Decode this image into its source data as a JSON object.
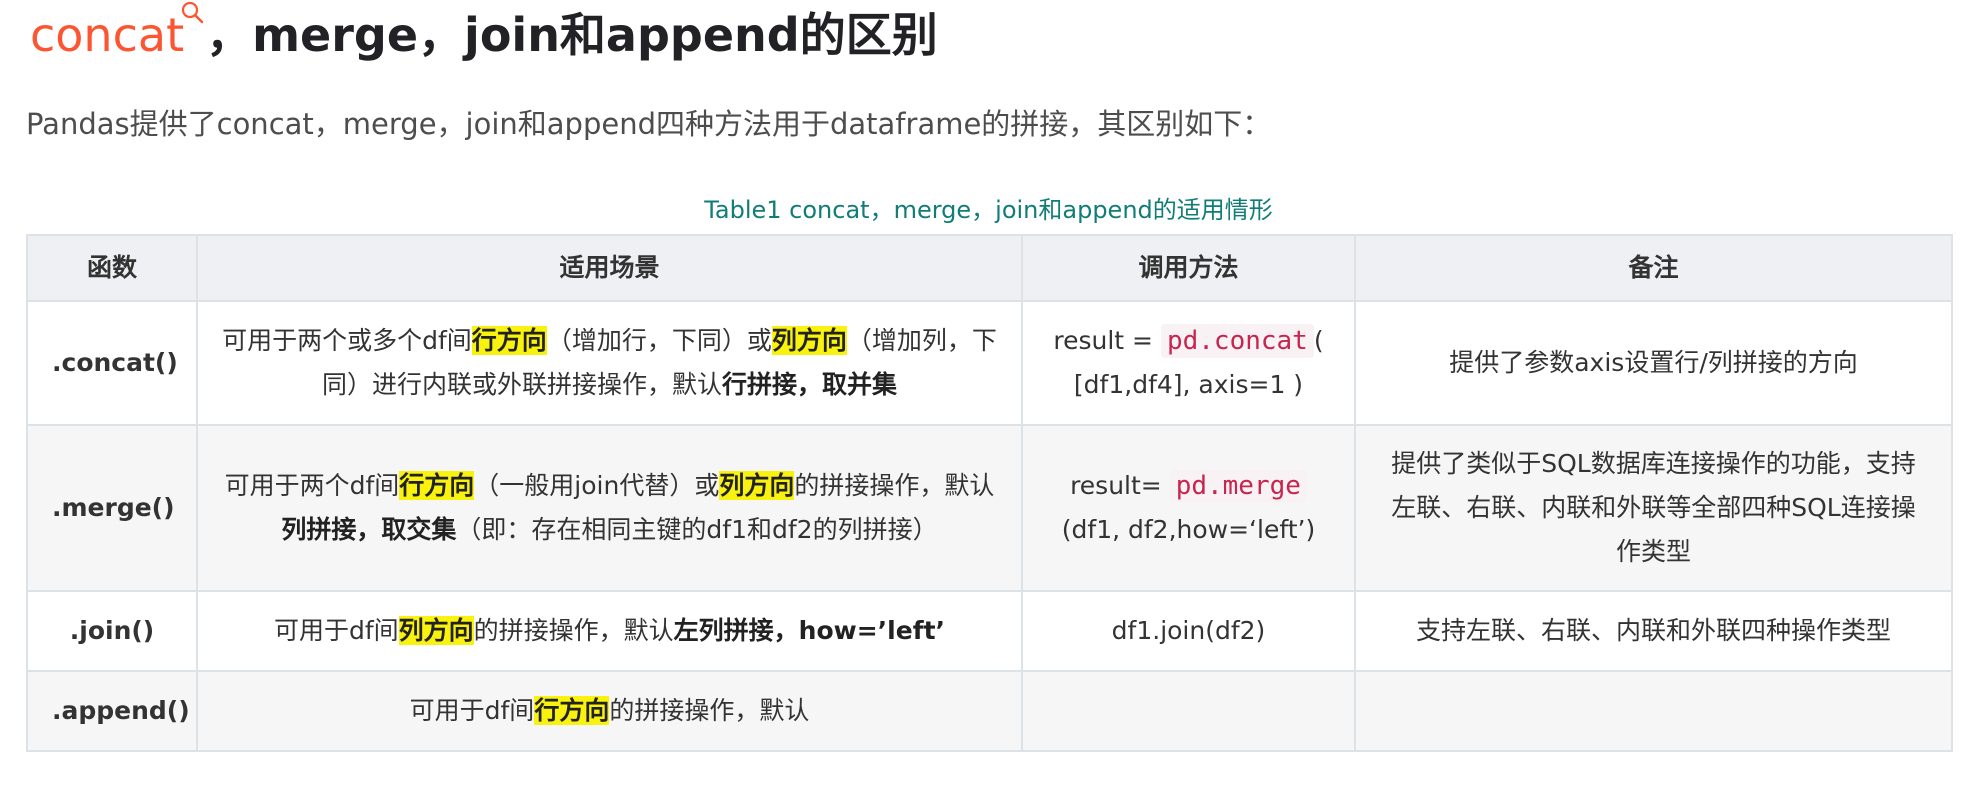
{
  "article": {
    "title_keyword": "concat",
    "title_rest": "，merge，join和append的区别",
    "intro": "Pandas提供了concat，merge，join和append四种方法用于dataframe的拼接，其区别如下："
  },
  "table": {
    "caption": "Table1 concat，merge，join和append的适用情形",
    "headers": [
      "函数",
      "适用场景",
      "调用方法",
      "备注"
    ],
    "rows": [
      {
        "func": ".concat()",
        "scene": [
          "可用于两个或多个df间",
          "行方向",
          "（增加行，下同）或",
          "列方向",
          "（增加列，下同）进行内联或外联拼接操作，默认",
          "行拼接，取并集"
        ],
        "call": [
          "result = ",
          "pd.concat",
          "( [df1,df4], axis=1 )"
        ],
        "note": "提供了参数axis设置行/列拼接的方向"
      },
      {
        "func": ".merge()",
        "scene": [
          "可用于两个df间",
          "行方向",
          "（一般用join代替）或",
          "列方向",
          "的拼接操作，默认",
          "列拼接，取交集",
          "（即：存在相同主键的df1和df2的列拼接）"
        ],
        "call": [
          "result= ",
          "pd.merge",
          " (df1, df2,how=‘left’)"
        ],
        "note": "提供了类似于SQL数据库连接操作的功能，支持左联、右联、内联和外联等全部四种SQL连接操作类型"
      },
      {
        "func": ".join()",
        "scene": [
          "可用于df间",
          "列方向",
          "的拼接操作，默认",
          "左列拼接，how=’left’"
        ],
        "call": "df1.join(df2)",
        "note": "支持左联、右联、内联和外联四种操作类型"
      },
      {
        "func": ".append()",
        "scene": [
          "可用于df间",
          "行方向",
          "的拼接操作，默认"
        ],
        "call": "",
        "note": ""
      }
    ]
  },
  "icons": {
    "keyword_search": "search-icon"
  },
  "colors": {
    "keyword": "#fc5531",
    "caption": "#117d77",
    "highlight": "#f9f20e",
    "code": "#c7254e",
    "header_bg": "#eef0f4",
    "border": "#dde2e6"
  }
}
